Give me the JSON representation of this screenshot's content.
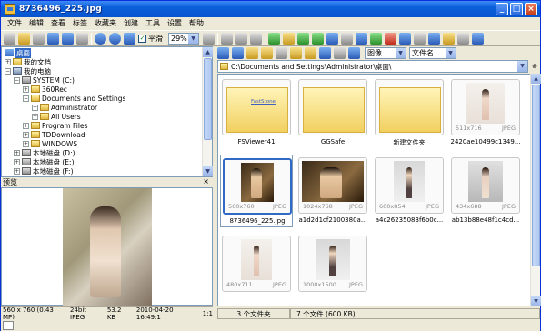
{
  "window": {
    "title": "8736496_225.jpg",
    "minimize": "_",
    "maximize": "□",
    "close": "×"
  },
  "menu": [
    "文件",
    "编辑",
    "查看",
    "标签",
    "收藏夹",
    "创建",
    "工具",
    "设置",
    "帮助"
  ],
  "toolbar": {
    "smooth_label": "平滑",
    "zoom_value": "29%",
    "view_mode": "图像",
    "sort_by": "文件名"
  },
  "tree": [
    {
      "label": "桌面",
      "selected": true
    },
    {
      "label": "我的文档"
    },
    {
      "label": "我的电脑"
    },
    {
      "label": "SYSTEM (C:)"
    },
    {
      "label": "360Rec"
    },
    {
      "label": "Documents and Settings"
    },
    {
      "label": "Administrator"
    },
    {
      "label": "All Users"
    },
    {
      "label": "Program Files"
    },
    {
      "label": "TDDownload"
    },
    {
      "label": "WINDOWS"
    },
    {
      "label": "本地磁盘 (D:)"
    },
    {
      "label": "本地磁盘 (E:)"
    },
    {
      "label": "本地磁盘 (F:)"
    }
  ],
  "preview": {
    "title": "预览",
    "close": "×"
  },
  "status_left": {
    "size": "560 x 760 (0.43 MP)",
    "depth": "24bit JPEG",
    "filesize": "53.2 KB",
    "date": "2010-04-20 16:49:1",
    "ratio": "1:1"
  },
  "address": {
    "path": "C:\\Documents and Settings\\Administrator\\桌面\\"
  },
  "files": [
    {
      "name": "FSViewer41",
      "type": "folder",
      "tag": "FastStone"
    },
    {
      "name": "GGSafe",
      "type": "folder"
    },
    {
      "name": "新建文件夹",
      "type": "folder"
    },
    {
      "name": "2420ae10499c1349...",
      "dims": "511x716",
      "fmt": "JPEG"
    },
    {
      "name": "8736496_225.jpg",
      "dims": "560x760",
      "fmt": "JPEG",
      "selected": true
    },
    {
      "name": "a1d2d1cf2100380a...",
      "dims": "1024x768",
      "fmt": "JPEG"
    },
    {
      "name": "a4c26235083f6b0c...",
      "dims": "600x854",
      "fmt": "JPEG"
    },
    {
      "name": "ab13b88e48f1c4cd...",
      "dims": "434x688",
      "fmt": "JPEG"
    },
    {
      "name": "",
      "dims": "480x711",
      "fmt": "JPEG"
    },
    {
      "name": "",
      "dims": "1000x1500",
      "fmt": "JPEG"
    }
  ],
  "status": {
    "folders": "3 个文件夹",
    "files": "7 个文件 (600 KB)"
  }
}
